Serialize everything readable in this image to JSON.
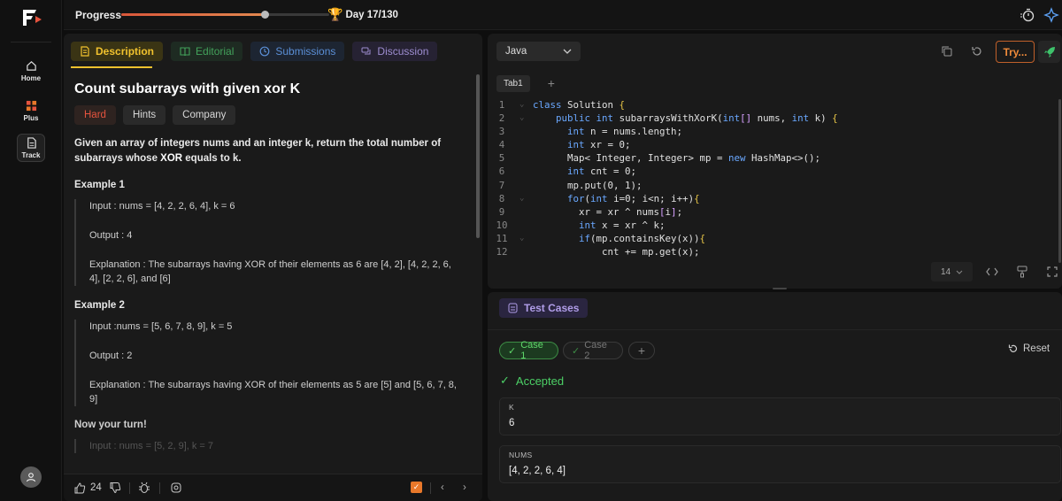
{
  "nav": {
    "items": [
      {
        "label": "Home",
        "icon": "home-icon"
      },
      {
        "label": "Plus",
        "icon": "plus-grid-icon"
      },
      {
        "label": "Track",
        "icon": "track-doc-icon"
      }
    ]
  },
  "topbar": {
    "progress_label": "Progress",
    "progress_fraction": 0.69,
    "day_label": "Day 17/130",
    "icons": [
      "timer-icon",
      "settings-spark-icon"
    ]
  },
  "problem": {
    "tabs": [
      {
        "label": "Description",
        "icon": "document-icon"
      },
      {
        "label": "Editorial",
        "icon": "book-icon"
      },
      {
        "label": "Submissions",
        "icon": "clock-icon"
      },
      {
        "label": "Discussion",
        "icon": "chat-icon"
      }
    ],
    "title": "Count subarrays with given xor K",
    "chips": [
      "Hard",
      "Hints",
      "Company"
    ],
    "statement_before": "Given an array of integers nums and an integer k, return the total number of subarrays whose ",
    "statement_bold": "XOR",
    "statement_after": " equals to k.",
    "examples": [
      {
        "title": "Example 1",
        "input": "Input : nums = [4, 2, 2, 6, 4], k = 6",
        "output": "Output : 4",
        "explanation": "Explanation : The subarrays having XOR of their elements as 6 are [4, 2],  [4, 2, 2, 6, 4], [2, 2, 6], and [6]"
      },
      {
        "title": "Example 2",
        "input": "Input :nums = [5, 6, 7, 8, 9], k = 5",
        "output": "Output : 2",
        "explanation": "Explanation : The subarrays having XOR of their elements as 5 are [5] and [5, 6, 7, 8, 9]"
      }
    ],
    "your_turn": "Now your turn!",
    "your_turn_input": "Input : nums = [5, 2, 9], k = 7"
  },
  "footer": {
    "likes": "24"
  },
  "editor": {
    "language": "Java",
    "try_label": "Try...",
    "tab": "Tab1",
    "font_size": "14",
    "lines": [
      {
        "n": "1",
        "code": "class Solution {"
      },
      {
        "n": "2",
        "code": "    public int subarraysWithXorK(int[] nums, int k) {"
      },
      {
        "n": "3",
        "code": "      int n = nums.length;"
      },
      {
        "n": "4",
        "code": "      int xr = 0;"
      },
      {
        "n": "5",
        "code": "      Map< Integer, Integer> mp = new HashMap<>();"
      },
      {
        "n": "6",
        "code": "      int cnt = 0;"
      },
      {
        "n": "7",
        "code": "      mp.put(0, 1);"
      },
      {
        "n": "8",
        "code": "      for(int i=0; i<n; i++){"
      },
      {
        "n": "9",
        "code": "        xr = xr ^ nums[i];"
      },
      {
        "n": "10",
        "code": "        int x = xr ^ k;"
      },
      {
        "n": "11",
        "code": "        if(mp.containsKey(x)){"
      },
      {
        "n": "12",
        "code": "            cnt += mp.get(x);"
      }
    ]
  },
  "tests": {
    "header": "Test Cases",
    "cases": [
      "Case 1",
      "Case 2"
    ],
    "add": "+",
    "reset": "Reset",
    "status": "Accepted",
    "fields": [
      {
        "label": "K",
        "value": "6"
      },
      {
        "label": "NUMS",
        "value": "[4, 2, 2, 6, 4]"
      }
    ]
  },
  "colors": {
    "accent_yellow": "#f1c22e",
    "hard_red": "#e5533e",
    "accepted_green": "#4cd066",
    "try_orange": "#f08a3a"
  }
}
